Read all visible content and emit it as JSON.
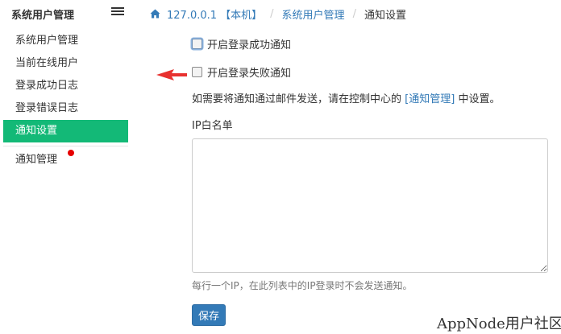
{
  "sidebar": {
    "title": "系统用户管理",
    "toggle_icon": "hamburger-icon",
    "items": [
      {
        "label": "系统用户管理"
      },
      {
        "label": "当前在线用户"
      },
      {
        "label": "登录成功日志"
      },
      {
        "label": "登录错误日志"
      },
      {
        "label": "通知设置"
      },
      {
        "label": "通知管理"
      }
    ],
    "active_index": 4
  },
  "breadcrumb": {
    "home_icon": "home-icon",
    "host": "127.0.0.1 【本机】",
    "section": "系统用户管理",
    "current": "通知设置"
  },
  "form": {
    "login_success_label": "开启登录成功通知",
    "login_success_checked": false,
    "login_fail_label": "开启登录失败通知",
    "login_fail_checked": false,
    "hint_prefix": "如需要将通知通过邮件发送，请在控制中心的",
    "hint_link": "[通知管理]",
    "hint_suffix": "中设置。",
    "ip_label": "IP白名单",
    "ip_value": "",
    "ip_help": "每行一个IP，在此列表中的IP登录时不会发送通知。",
    "save_label": "保存"
  },
  "colors": {
    "active_nav": "#13b977",
    "link": "#337ab7",
    "primary_button": "#337ab7",
    "arrow": "#e8312f",
    "badge_dot": "#e60000"
  },
  "watermark": "AppNode用户社区"
}
